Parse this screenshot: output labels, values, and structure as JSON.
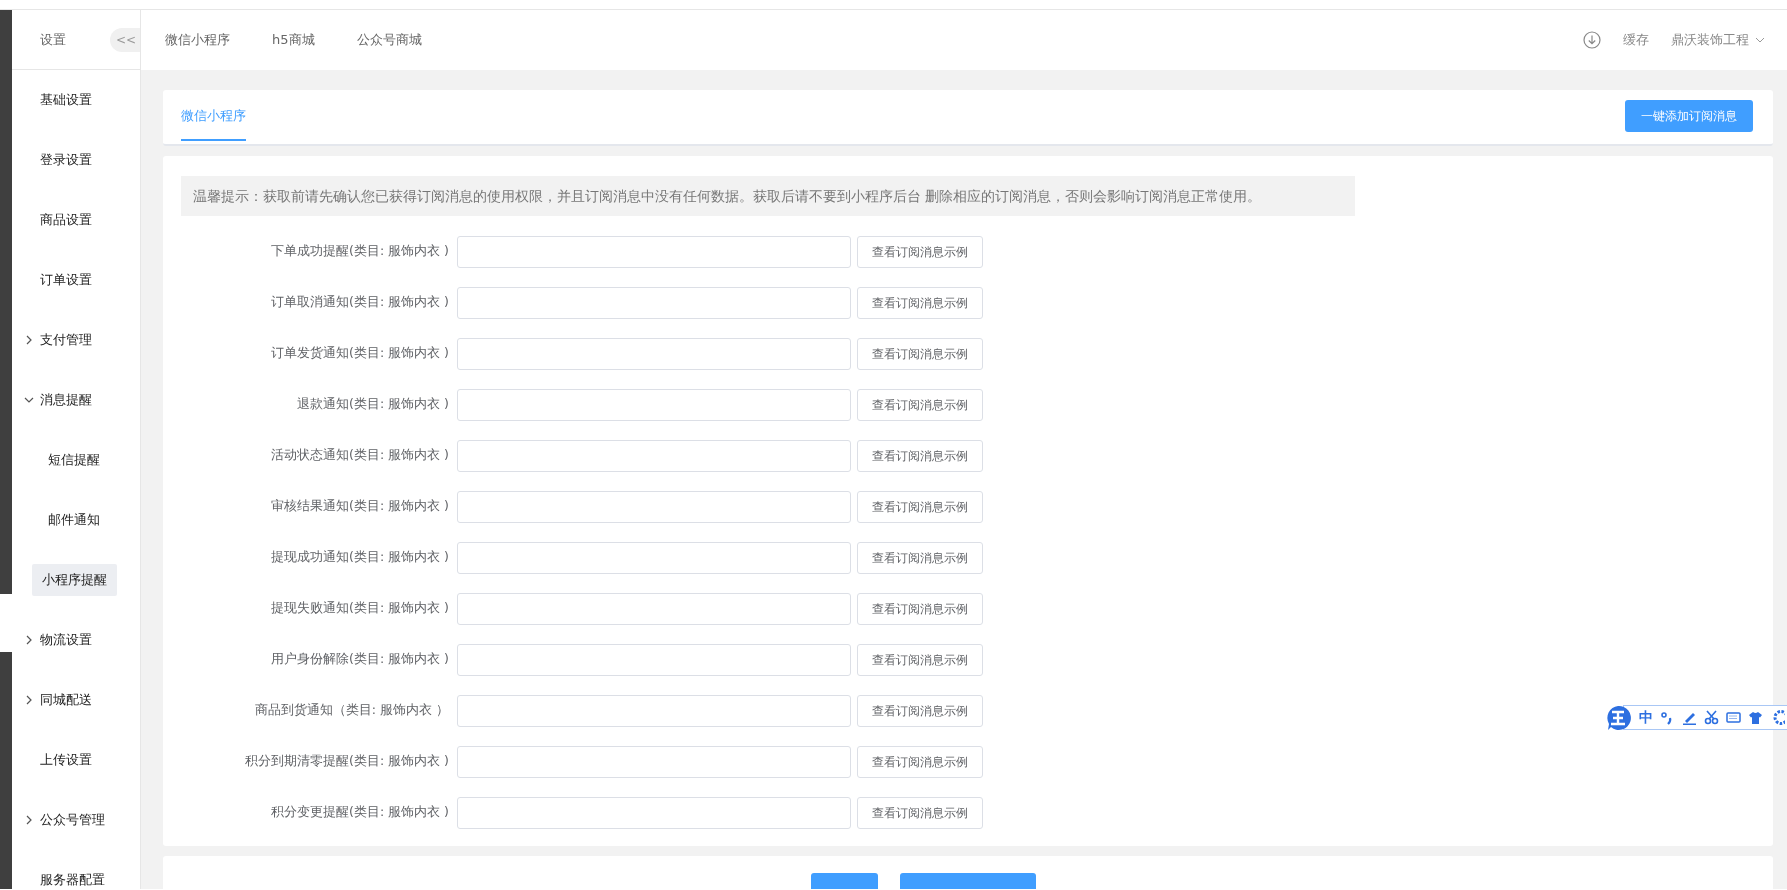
{
  "sidebar": {
    "title": "设置",
    "collapse_button": "<<",
    "items": [
      {
        "label": "基础设置",
        "kind": "page",
        "selected": false
      },
      {
        "label": "登录设置",
        "kind": "page",
        "selected": false
      },
      {
        "label": "商品设置",
        "kind": "page",
        "selected": false
      },
      {
        "label": "订单设置",
        "kind": "page",
        "selected": false
      },
      {
        "label": "支付管理",
        "kind": "group",
        "expanded": false,
        "selected": false
      },
      {
        "label": "消息提醒",
        "kind": "group",
        "expanded": true,
        "selected": false,
        "children": [
          {
            "label": "短信提醒",
            "selected": false
          },
          {
            "label": "邮件通知",
            "selected": false
          },
          {
            "label": "小程序提醒",
            "selected": true
          }
        ]
      },
      {
        "label": "物流设置",
        "kind": "group",
        "expanded": false,
        "selected": false
      },
      {
        "label": "同城配送",
        "kind": "group",
        "expanded": false,
        "selected": false
      },
      {
        "label": "上传设置",
        "kind": "page",
        "selected": false
      },
      {
        "label": "公众号管理",
        "kind": "group",
        "expanded": false,
        "selected": false
      },
      {
        "label": "服务器配置",
        "kind": "page",
        "selected": false
      }
    ]
  },
  "top_nav": {
    "links": [
      {
        "label": "微信小程序"
      },
      {
        "label": "h5商城"
      },
      {
        "label": "公众号商城"
      }
    ],
    "cache": "缓存",
    "user": "鼎沃装饰工程"
  },
  "tabs_card": {
    "tabs": [
      {
        "label": "微信小程序",
        "selected": true
      }
    ],
    "add_button": "一键添加订阅消息"
  },
  "notice": "温馨提示：获取前请先确认您已获得订阅消息的使用权限，并且订阅消息中没有任何数据。获取后请不要到小程序后台 删除相应的订阅消息，否则会影响订阅消息正常使用。",
  "form_rows": [
    {
      "label": "下单成功提醒(类目: 服饰内衣 )",
      "button": "查看订阅消息示例"
    },
    {
      "label": "订单取消通知(类目: 服饰内衣 )",
      "button": "查看订阅消息示例"
    },
    {
      "label": "订单发货通知(类目: 服饰内衣 )",
      "button": "查看订阅消息示例"
    },
    {
      "label": "退款通知(类目: 服饰内衣 )",
      "button": "查看订阅消息示例"
    },
    {
      "label": "活动状态通知(类目: 服饰内衣 )",
      "button": "查看订阅消息示例"
    },
    {
      "label": "审核结果通知(类目: 服饰内衣 )",
      "button": "查看订阅消息示例"
    },
    {
      "label": "提现成功通知(类目: 服饰内衣 )",
      "button": "查看订阅消息示例"
    },
    {
      "label": "提现失败通知(类目: 服饰内衣 )",
      "button": "查看订阅消息示例"
    },
    {
      "label": "用户身份解除(类目: 服饰内衣 )",
      "button": "查看订阅消息示例"
    },
    {
      "label": "商品到货通知（类目: 服饰内衣 ）",
      "button": "查看订阅消息示例"
    },
    {
      "label": "积分到期清零提醒(类目: 服饰内衣 )",
      "button": "查看订阅消息示例"
    },
    {
      "label": "积分变更提醒(类目: 服饰内衣 )",
      "button": "查看订阅消息示例"
    }
  ],
  "footer": {
    "buttons": [
      {
        "kind": "short"
      },
      {
        "kind": "wide"
      }
    ]
  },
  "ime_toolbar": {
    "mode": "中"
  }
}
